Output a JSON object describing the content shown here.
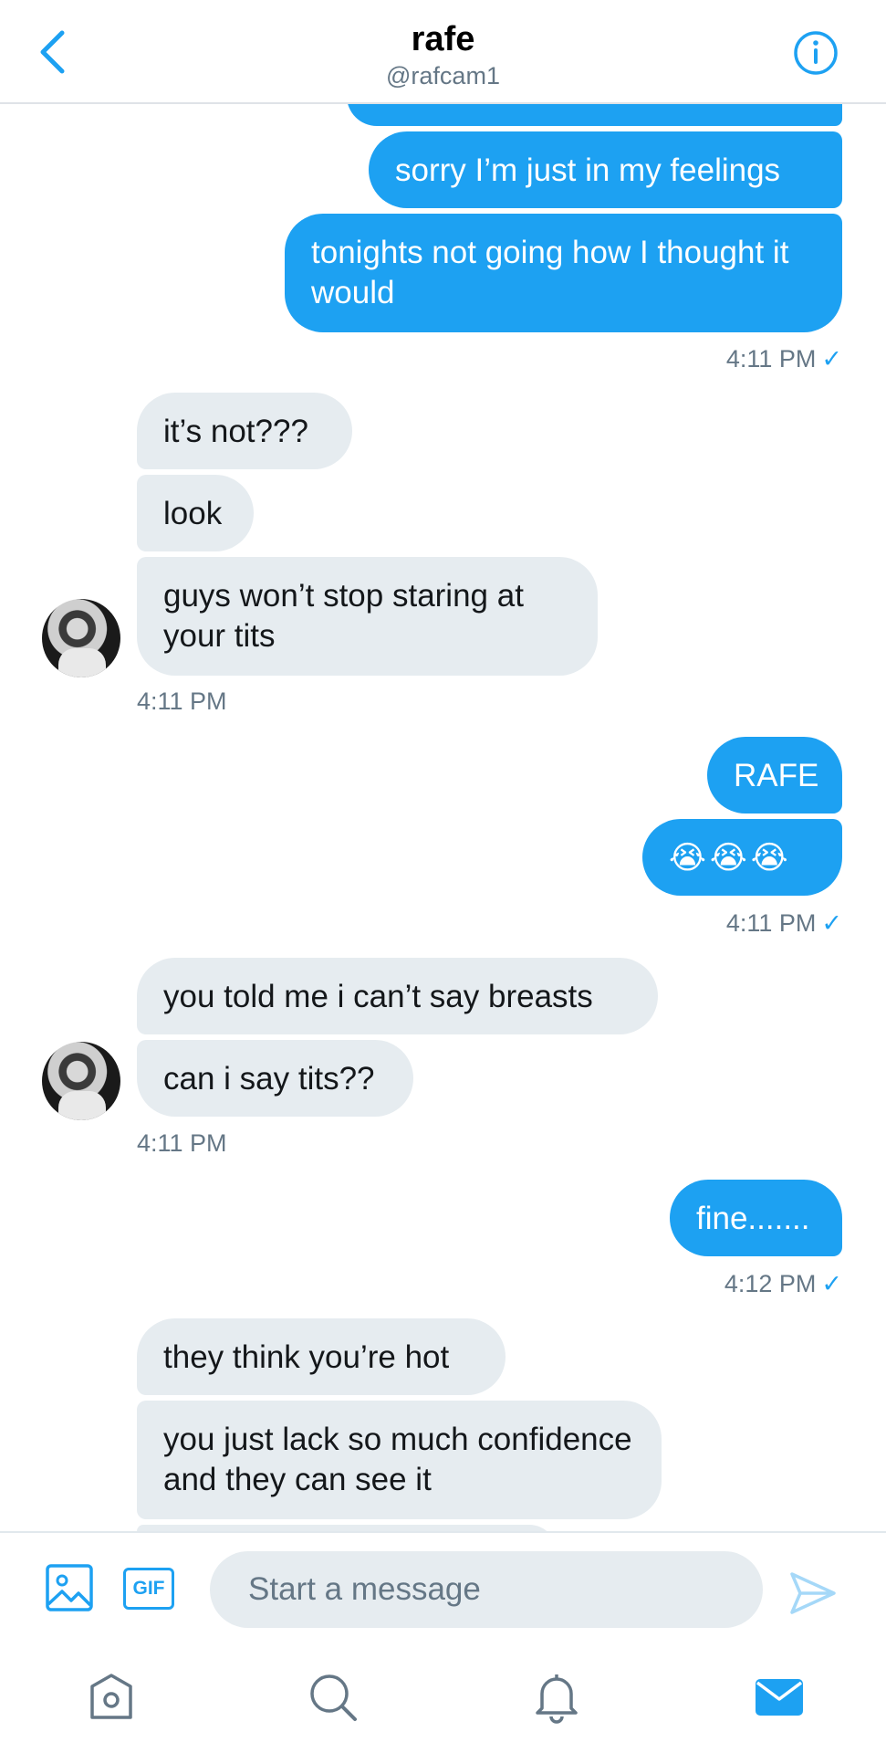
{
  "header": {
    "title": "rafe",
    "handle": "@rafcam1",
    "back_icon": "chevron-left-icon",
    "info_icon": "info-icon"
  },
  "messages": [
    {
      "direction": "out",
      "text": "sorry I’m just in my feelings"
    },
    {
      "direction": "out",
      "text": "tonights not going how I thought it would"
    },
    {
      "meta": "4:11 PM",
      "check": "✓"
    },
    {
      "direction": "in",
      "text": "it’s not???"
    },
    {
      "direction": "in",
      "text": "look"
    },
    {
      "direction": "in",
      "text": "guys won’t stop staring at your tits"
    },
    {
      "meta": "4:11 PM"
    },
    {
      "direction": "out",
      "text": "RAFE"
    },
    {
      "direction": "out",
      "text": "😭😭😭"
    },
    {
      "meta": "4:11 PM",
      "check": "✓"
    },
    {
      "direction": "in",
      "text": "you told me i can’t say breasts"
    },
    {
      "direction": "in",
      "text": "can i say tits??"
    },
    {
      "meta": "4:11 PM"
    },
    {
      "direction": "out",
      "text": "fine......."
    },
    {
      "meta": "4:12 PM",
      "check": "✓"
    },
    {
      "direction": "in",
      "text": "they think you’re hot"
    },
    {
      "direction": "in",
      "text": "you just lack so much confidence and they can see it"
    }
  ],
  "composer": {
    "placeholder": "Start a message",
    "gif_label": "GIF",
    "image_icon": "image-icon",
    "send_icon": "send-icon"
  },
  "nav": [
    "home-icon",
    "search-icon",
    "notifications-icon",
    "messages-icon"
  ],
  "colors": {
    "accent": "#1da1f2",
    "incoming_bubble": "#e6ecf0",
    "muted_text": "#657786"
  }
}
